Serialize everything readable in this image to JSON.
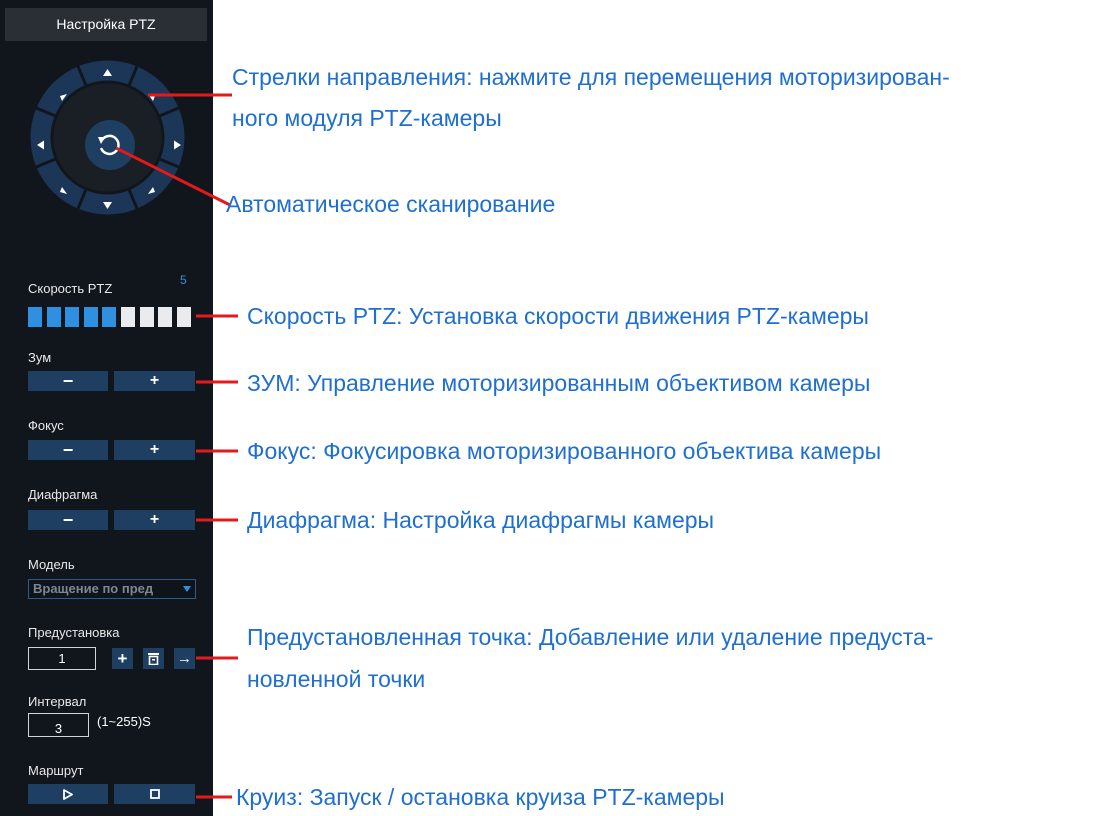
{
  "panel": {
    "title": "Настройка PTZ",
    "speed": {
      "label": "Скорость PTZ",
      "value": "5",
      "level": 5,
      "segments": 9,
      "active_color": "#2f8fe0",
      "inactive_color": "#e9ebee"
    },
    "zoom": {
      "label": "Зум",
      "minus": "−",
      "plus": "+"
    },
    "focus": {
      "label": "Фокус",
      "minus": "−",
      "plus": "+"
    },
    "iris": {
      "label": "Диафрагма",
      "minus": "−",
      "plus": "+"
    },
    "model": {
      "label": "Модель",
      "selected": "Вращение по пред"
    },
    "preset": {
      "label": "Предустановка",
      "value": "1",
      "add": "+",
      "goto": "→"
    },
    "interval": {
      "label": "Интервал",
      "value": "3",
      "range": "(1~255)S"
    },
    "cruise": {
      "label": "Маршрут",
      "play": "▷",
      "stop": "◻"
    }
  },
  "annotations": {
    "arrows_line1": "Стрелки направления: нажмите для перемещения моторизирован-",
    "arrows_line2": "ного модуля PTZ-камеры",
    "autoscan": "Автоматическое сканирование",
    "speed": "Скорость PTZ: Установка скорости движения PTZ-камеры",
    "zoom": "ЗУМ: Управление моторизированным объективом камеры",
    "focus": "Фокус: Фокусировка моторизированного объектива камеры",
    "iris": "Диафрагма: Настройка диафрагмы камеры",
    "preset_line1": "Предустановленная точка: Добавление или удаление предуста-",
    "preset_line2": "новленной точки",
    "cruise": "Круиз: Запуск / остановка круиза PTZ-камеры"
  },
  "colors": {
    "panel_bg": "#11161d",
    "button_bg": "#1e3f62",
    "accent": "#2f8fe0",
    "annotation_text": "#1f6fd1",
    "pointer_line": "#e31a1a"
  }
}
